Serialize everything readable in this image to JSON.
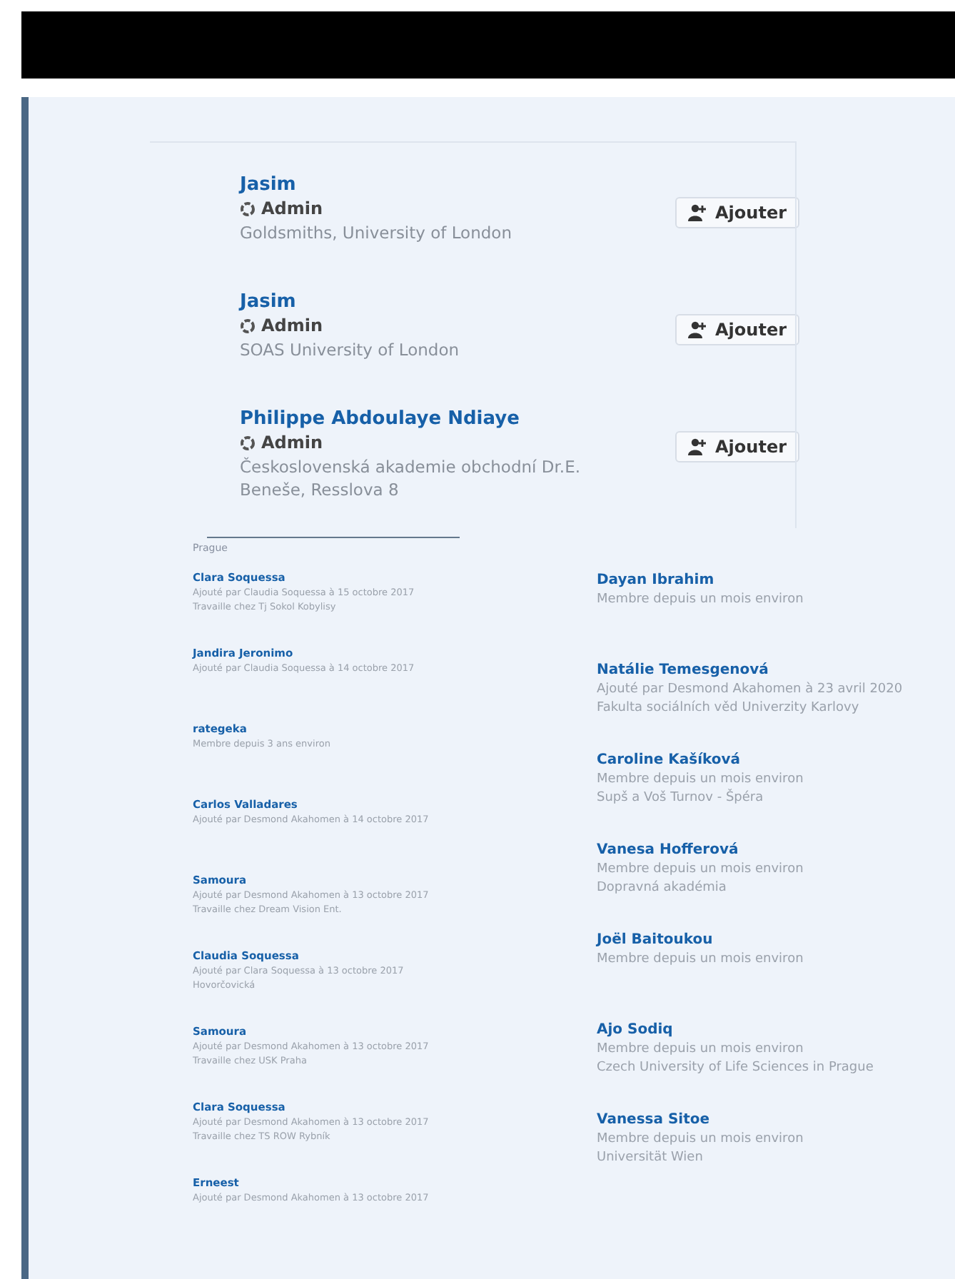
{
  "members": [
    {
      "name": "Jasim",
      "role": "Admin",
      "org": "Goldsmiths, University of London",
      "button": "Ajouter"
    },
    {
      "name": "Jasim",
      "role": "Admin",
      "org": "SOAS University of London",
      "button": "Ajouter"
    },
    {
      "name": "Philippe Abdoulaye Ndiaye",
      "role": "Admin",
      "org": "Československá akademie obchodní Dr.E. Beneše, Resslova 8",
      "button": "Ajouter"
    }
  ],
  "city": "Prague",
  "left_list": [
    {
      "name": "Clara Soquessa",
      "lines": [
        "Ajouté par Claudia Soquessa à 15 octobre 2017",
        "Travaille chez Tj Sokol Kobylisy"
      ]
    },
    {
      "name": "Jandira Jeronimo",
      "lines": [
        "Ajouté par Claudia Soquessa à 14 octobre 2017"
      ]
    },
    {
      "name": "rategeka",
      "lines": [
        "Membre depuis 3 ans environ"
      ]
    },
    {
      "name": "Carlos Valladares",
      "lines": [
        "Ajouté par Desmond Akahomen à 14 octobre 2017"
      ]
    },
    {
      "name": "Samoura",
      "lines": [
        "Ajouté par Desmond Akahomen à 13 octobre 2017",
        "Travaille chez Dream Vision Ent."
      ]
    },
    {
      "name": "Claudia Soquessa",
      "lines": [
        "Ajouté par Clara Soquessa à 13 octobre 2017",
        "Hovorčovická"
      ]
    },
    {
      "name": "Samoura",
      "lines": [
        "Ajouté par Desmond Akahomen à 13 octobre 2017",
        "Travaille chez USK Praha"
      ]
    },
    {
      "name": "Clara Soquessa",
      "lines": [
        "Ajouté par Desmond Akahomen à 13 octobre 2017",
        "Travaille chez TS ROW Rybník"
      ]
    },
    {
      "name": "Erneest",
      "lines": [
        "Ajouté par Desmond Akahomen à 13 octobre 2017"
      ]
    }
  ],
  "right_list": [
    {
      "name": "Dayan Ibrahim",
      "lines": [
        "Membre depuis un mois environ"
      ]
    },
    {
      "name": "Natálie Temesgenová",
      "lines": [
        "Ajouté par Desmond Akahomen à 23 avril 2020",
        "Fakulta sociálních věd Univerzity Karlovy"
      ]
    },
    {
      "name": "Caroline Kašíková",
      "lines": [
        "Membre depuis un mois environ",
        "Supš a Voš Turnov - Špéra"
      ]
    },
    {
      "name": "Vanesa Hofferová",
      "lines": [
        "Membre depuis un mois environ",
        "Dopravná akadémia"
      ]
    },
    {
      "name": "Joël Baitoukou",
      "lines": [
        "Membre depuis un mois environ"
      ]
    },
    {
      "name": "Ajo Sodiq",
      "lines": [
        "Membre depuis un mois environ",
        "Czech University of Life Sciences in Prague"
      ]
    },
    {
      "name": "Vanessa Sitoe",
      "lines": [
        "Membre depuis un mois environ",
        "Universität Wien"
      ]
    }
  ]
}
